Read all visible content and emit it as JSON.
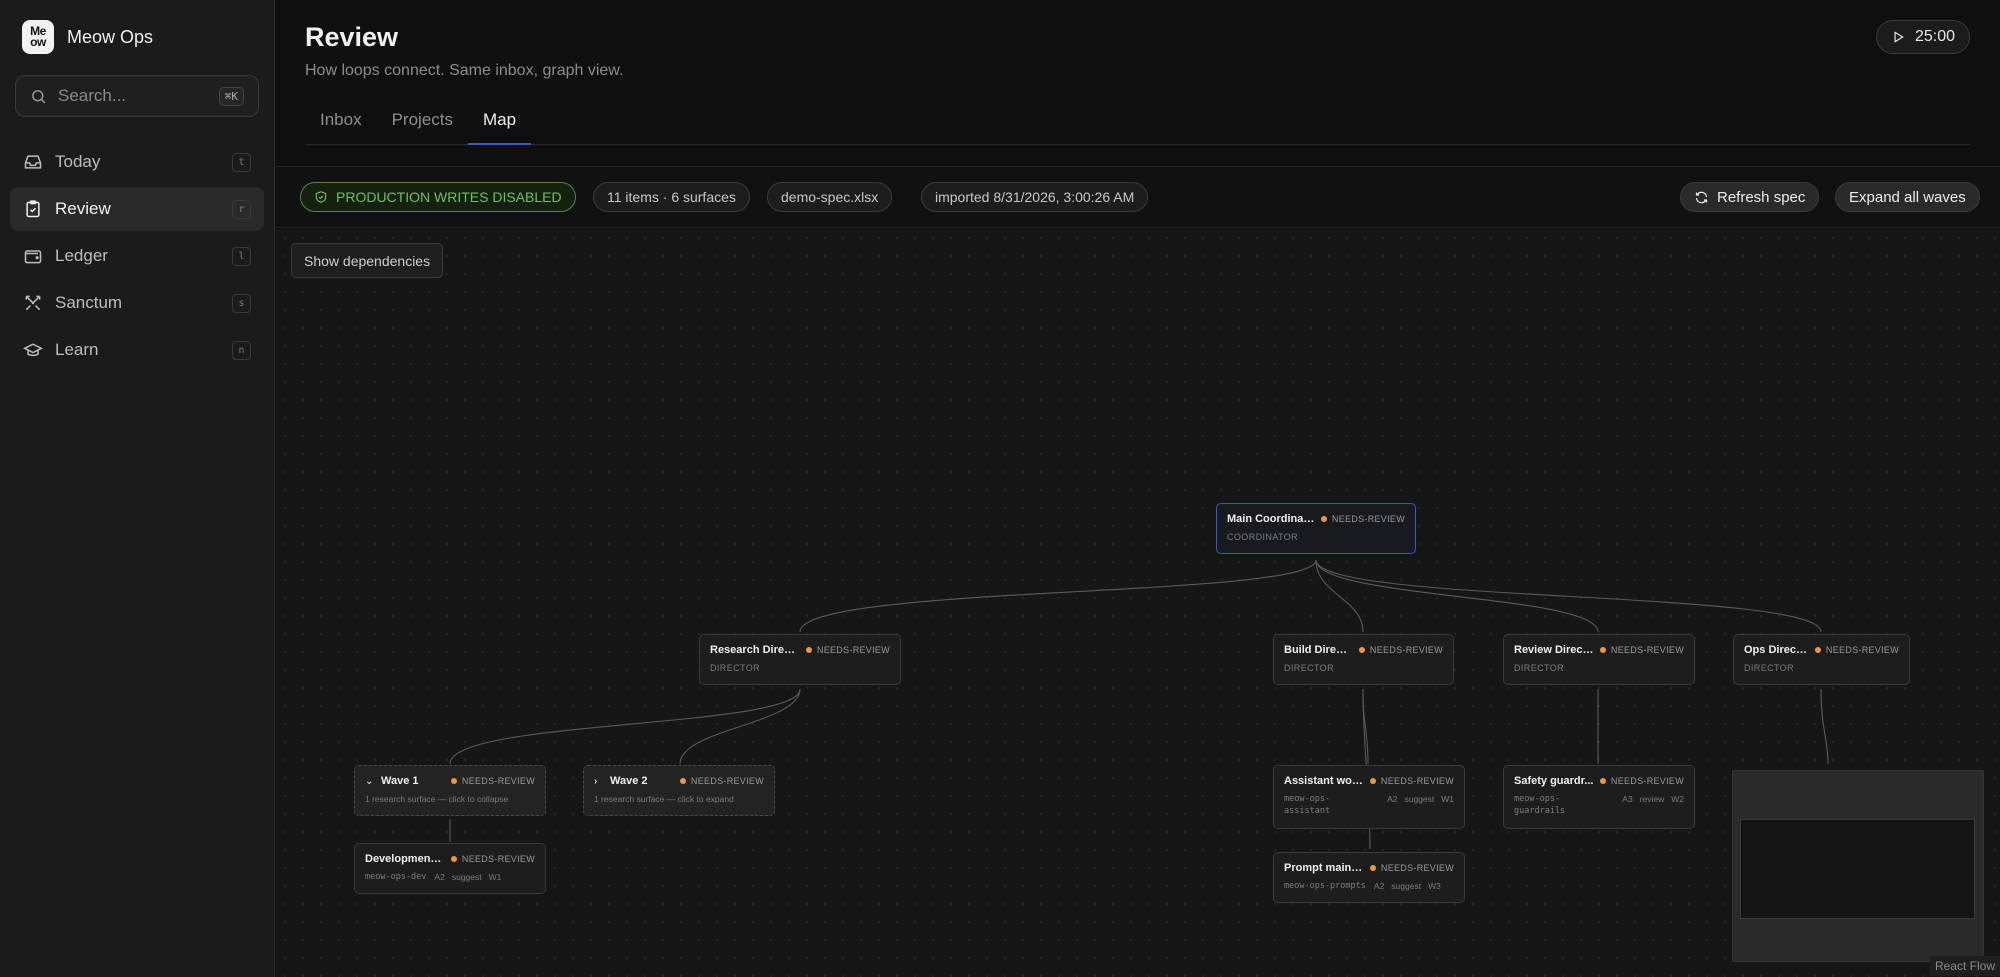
{
  "brand": {
    "logo_text": "Meow",
    "name": "Meow Ops"
  },
  "search": {
    "placeholder": "Search...",
    "shortcut": "⌘K"
  },
  "sidebar": {
    "items": [
      {
        "label": "Today",
        "key": "t",
        "icon": "inbox-icon"
      },
      {
        "label": "Review",
        "key": "r",
        "icon": "clipboard-check-icon",
        "active": true
      },
      {
        "label": "Ledger",
        "key": "l",
        "icon": "wallet-icon"
      },
      {
        "label": "Sanctum",
        "key": "s",
        "icon": "swords-icon"
      },
      {
        "label": "Learn",
        "key": "n",
        "icon": "graduation-cap-icon"
      }
    ]
  },
  "header": {
    "title": "Review",
    "subtitle": "How loops connect. Same inbox, graph view.",
    "timer": "25:00"
  },
  "tabs": [
    {
      "label": "Inbox"
    },
    {
      "label": "Projects"
    },
    {
      "label": "Map",
      "active": true
    }
  ],
  "toolbar": {
    "production_badge": "PRODUCTION WRITES DISABLED",
    "counts": "11 items · 6 surfaces",
    "file": "demo-spec.xlsx",
    "imported": "imported 8/31/2026, 3:00:26 AM",
    "refresh_label": "Refresh spec",
    "expand_label": "Expand all waves"
  },
  "canvas": {
    "show_dependencies_label": "Show dependencies",
    "attribution": "React Flow"
  },
  "colors": {
    "accent": "#2f5dd0",
    "status_dot": "#f0963a",
    "production_green": "#6fc25a"
  },
  "graph": {
    "nodes": {
      "main": {
        "title": "Main Coordinator",
        "status": "NEEDS-REVIEW",
        "role": "COORDINATOR"
      },
      "research": {
        "title": "Research Director",
        "status": "NEEDS-REVIEW",
        "role": "DIRECTOR"
      },
      "build": {
        "title": "Build Director",
        "status": "NEEDS-REVIEW",
        "role": "DIRECTOR"
      },
      "review": {
        "title": "Review Director",
        "status": "NEEDS-REVIEW",
        "role": "DIRECTOR"
      },
      "ops": {
        "title": "Ops Director",
        "status": "NEEDS-REVIEW",
        "role": "DIRECTOR"
      },
      "wave1": {
        "title": "Wave 1",
        "status": "NEEDS-REVIEW",
        "hint": "1 research surface — click to collapse",
        "chevron": "⌄"
      },
      "wave2": {
        "title": "Wave 2",
        "status": "NEEDS-REVIEW",
        "hint": "1 research surface — click to expand",
        "chevron": "›"
      },
      "development": {
        "title": "Development ...",
        "status": "NEEDS-REVIEW",
        "id": "meow-ops-dev",
        "tags": [
          "A2",
          "suggest",
          "W1"
        ]
      },
      "assistant": {
        "title": "Assistant wor...",
        "status": "NEEDS-REVIEW",
        "id": "meow-ops-\nassistant",
        "tags": [
          "A2",
          "suggest",
          "W1"
        ]
      },
      "prompt": {
        "title": "Prompt maint...",
        "status": "NEEDS-REVIEW",
        "id": "meow-ops-prompts",
        "tags": [
          "A2",
          "suggest",
          "W3"
        ]
      },
      "safety": {
        "title": "Safety guardr...",
        "status": "NEEDS-REVIEW",
        "id": "meow-ops-\nguardrails",
        "tags": [
          "A3",
          "review",
          "W2"
        ]
      }
    }
  }
}
